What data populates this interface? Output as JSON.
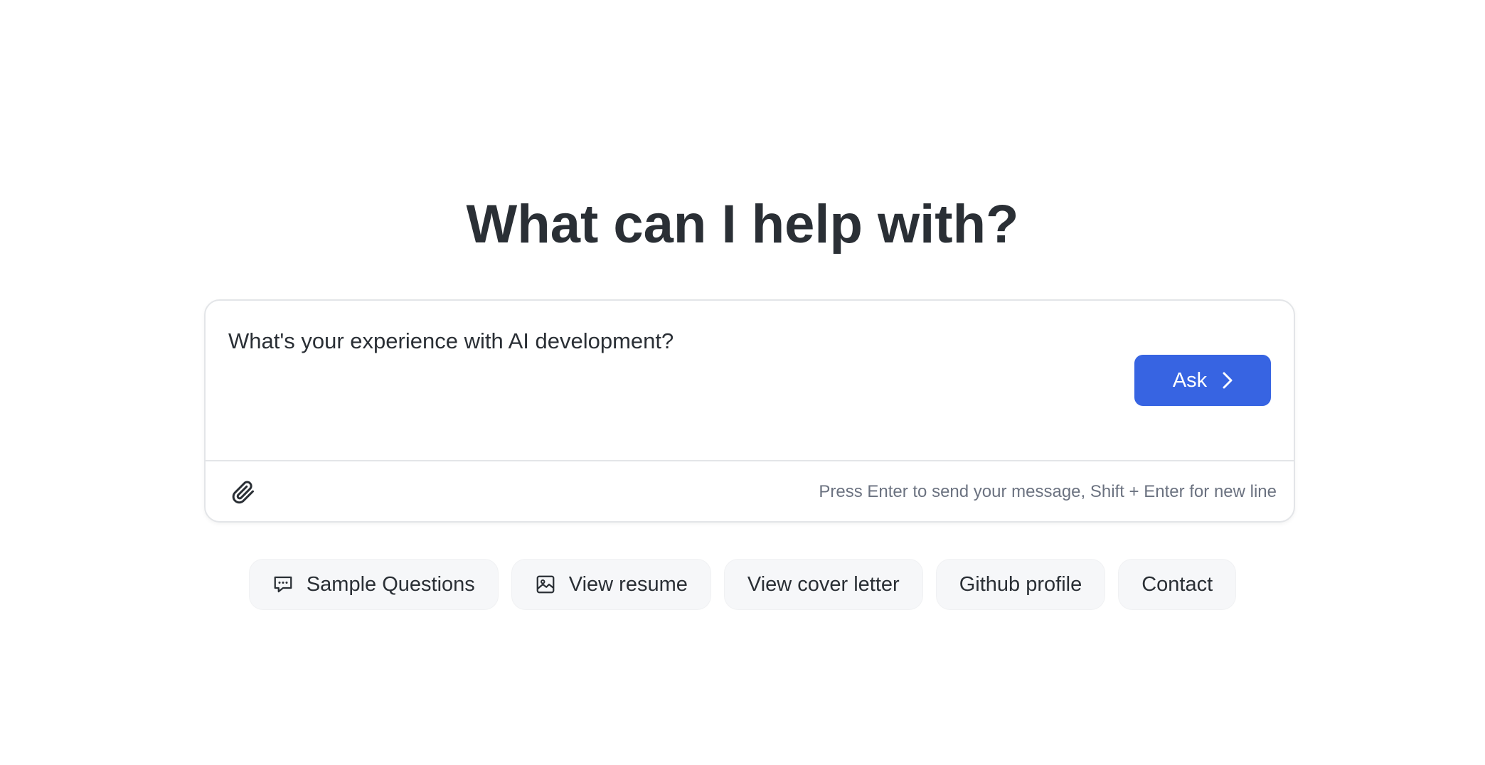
{
  "heading": "What can I help with?",
  "composer": {
    "input_value": "What's your experience with AI development?",
    "ask_label": "Ask",
    "hint": "Press Enter to send your message, Shift + Enter for new line",
    "attach_icon": "paperclip-icon",
    "ask_icon": "chevron-right-icon"
  },
  "chips": [
    {
      "label": "Sample Questions",
      "icon": "chat-bubble-icon"
    },
    {
      "label": "View resume",
      "icon": "image-icon"
    },
    {
      "label": "View cover letter"
    },
    {
      "label": "Github profile"
    },
    {
      "label": "Contact"
    }
  ],
  "colors": {
    "accent": "#3764e2",
    "text": "#2a2f35",
    "muted": "#6b7280",
    "chip_bg": "#f6f7f9",
    "border": "#e3e5e8"
  }
}
